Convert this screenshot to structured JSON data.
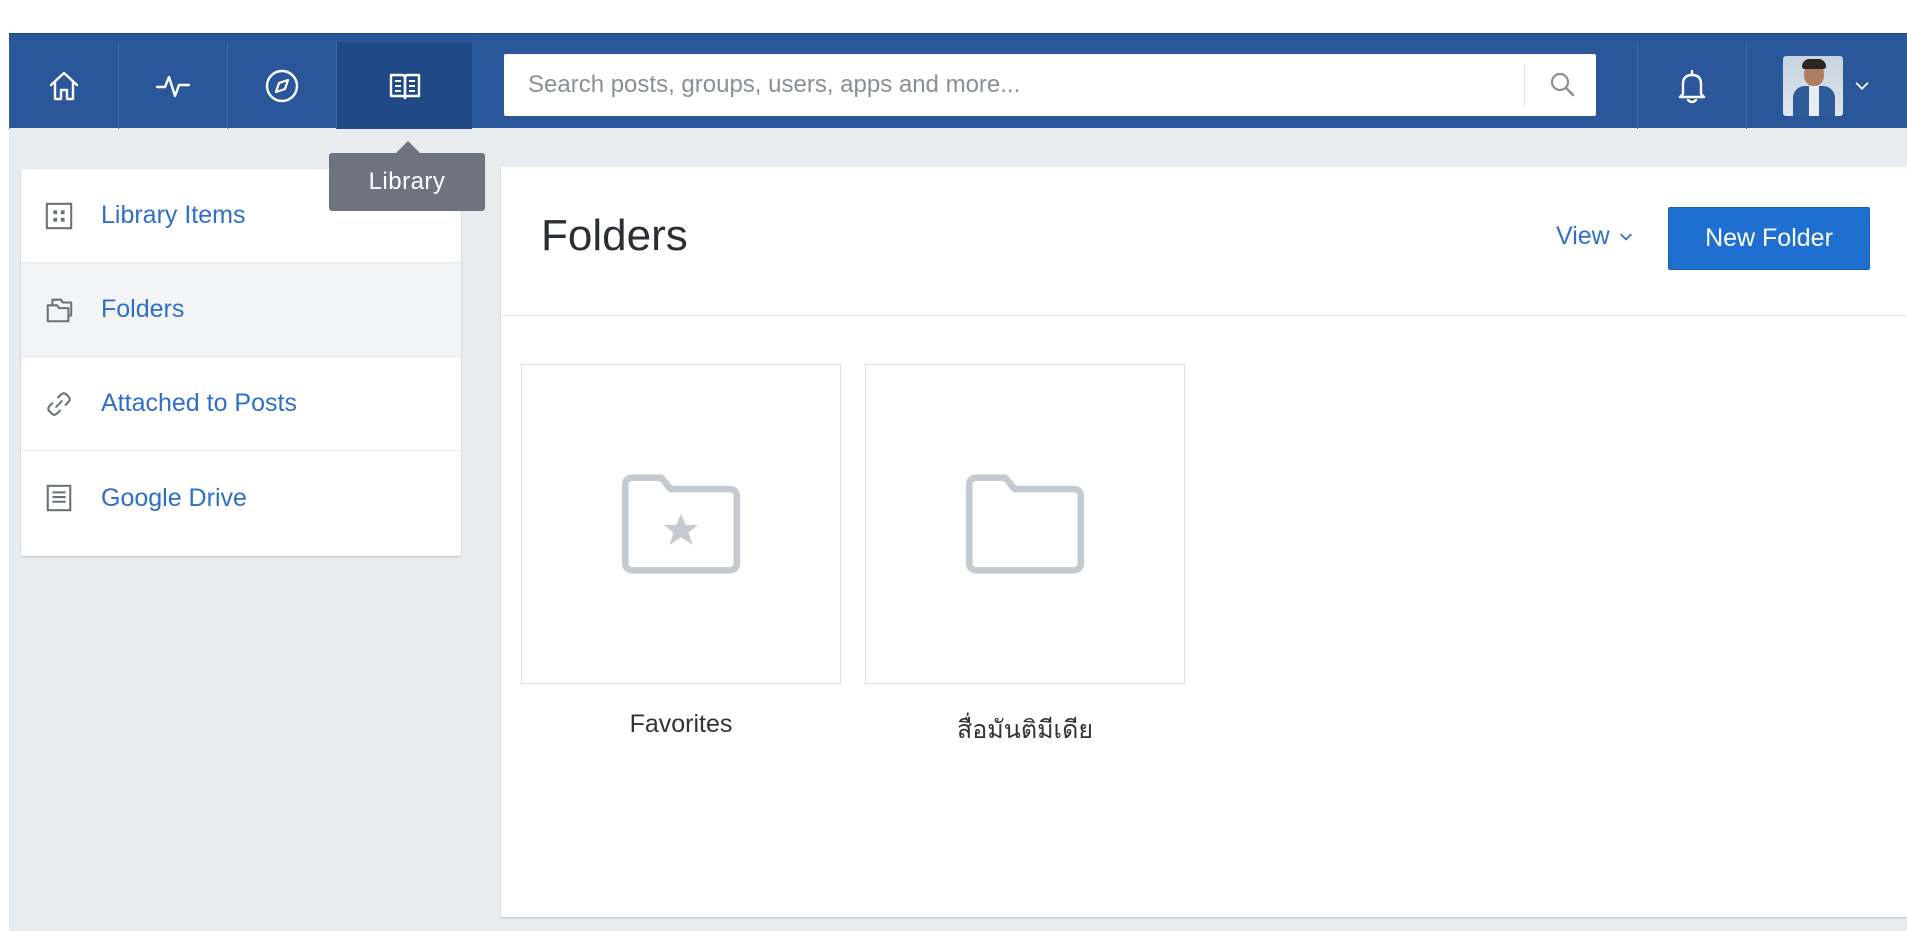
{
  "nav": {
    "items": [
      {
        "name": "home",
        "icon": "home-icon"
      },
      {
        "name": "activity",
        "icon": "activity-icon"
      },
      {
        "name": "discover",
        "icon": "compass-icon"
      },
      {
        "name": "library",
        "icon": "library-book-icon",
        "active": true
      }
    ],
    "tooltip": "Library"
  },
  "search": {
    "placeholder": "Search posts, groups, users, apps and more...",
    "icon": "search-icon"
  },
  "header": {
    "notifications_icon": "bell-icon",
    "account_icon": "chevron-down-icon"
  },
  "sidebar": {
    "items": [
      {
        "label": "Library Items",
        "icon": "grid-icon"
      },
      {
        "label": "Folders",
        "icon": "folders-icon",
        "selected": true
      },
      {
        "label": "Attached to Posts",
        "icon": "link-icon"
      },
      {
        "label": "Google Drive",
        "icon": "document-icon"
      }
    ]
  },
  "main": {
    "title": "Folders",
    "view_label": "View",
    "new_folder_label": "New Folder",
    "folders": [
      {
        "name": "Favorites",
        "icon": "star-folder-icon"
      },
      {
        "name": "สื่อมันติมีเดีย",
        "icon": "folder-icon"
      }
    ]
  },
  "colors": {
    "topbar": "#2a5799",
    "accent": "#1f6fd0",
    "link": "#2f6fc6",
    "background": "#e9ecef"
  }
}
